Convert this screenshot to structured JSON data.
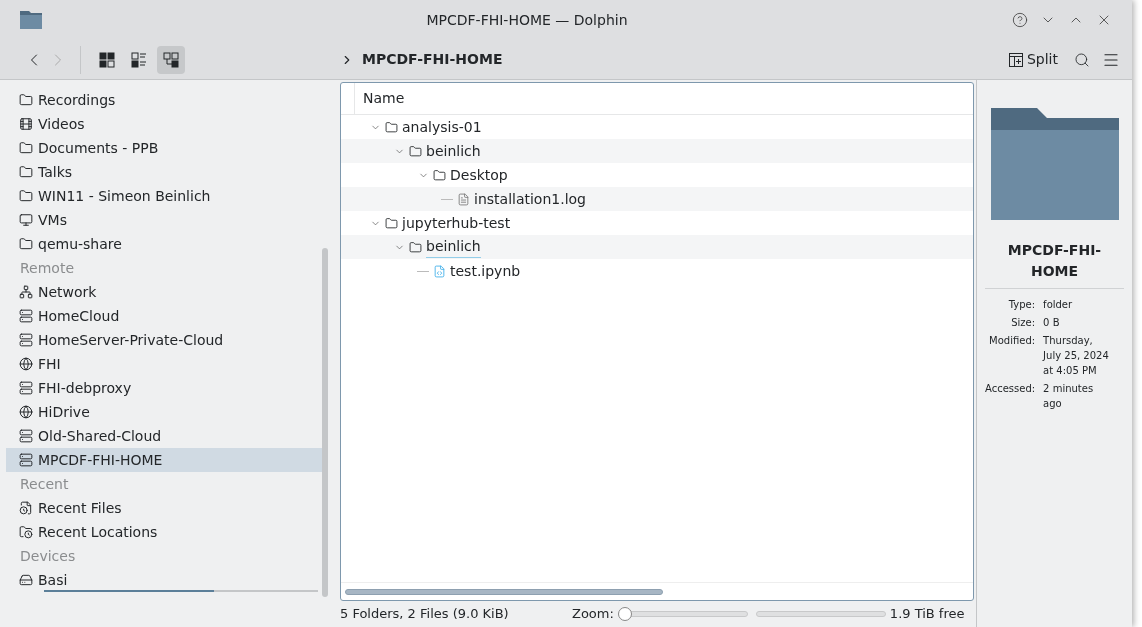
{
  "window": {
    "title": "MPCDF-FHI-HOME — Dolphin"
  },
  "toolbar": {
    "view_modes": [
      {
        "kind": "icons",
        "selected": false
      },
      {
        "kind": "compact",
        "selected": false
      },
      {
        "kind": "details",
        "selected": true
      }
    ],
    "breadcrumb": "MPCDF-FHI-HOME",
    "split_label": "Split"
  },
  "sidebar": {
    "sections": [
      {
        "items": [
          {
            "label": "Recordings",
            "kind": "folder",
            "selected": false
          },
          {
            "label": "Videos",
            "kind": "video",
            "selected": false
          },
          {
            "label": "Documents - PPB",
            "kind": "folder",
            "selected": false
          },
          {
            "label": "Talks",
            "kind": "folder",
            "selected": false
          },
          {
            "label": "WIN11 - Simeon Beinlich",
            "kind": "folder",
            "selected": false
          },
          {
            "label": "VMs",
            "kind": "monitor",
            "selected": false
          },
          {
            "label": "qemu-share",
            "kind": "folder",
            "selected": false
          }
        ]
      },
      {
        "title": "Remote",
        "items": [
          {
            "label": "Network",
            "kind": "network",
            "selected": false
          },
          {
            "label": "HomeCloud",
            "kind": "server",
            "selected": false
          },
          {
            "label": "HomeServer-Private-Cloud",
            "kind": "server",
            "selected": false
          },
          {
            "label": "FHI",
            "kind": "globe",
            "selected": false
          },
          {
            "label": "FHI-debproxy",
            "kind": "server",
            "selected": false
          },
          {
            "label": "HiDrive",
            "kind": "globe",
            "selected": false
          },
          {
            "label": "Old-Shared-Cloud",
            "kind": "server",
            "selected": false
          },
          {
            "label": "MPCDF-FHI-HOME",
            "kind": "server",
            "selected": true
          }
        ]
      },
      {
        "title": "Recent",
        "items": [
          {
            "label": "Recent Files",
            "kind": "recent-file",
            "selected": false
          },
          {
            "label": "Recent Locations",
            "kind": "recent-folder",
            "selected": false
          }
        ]
      },
      {
        "title": "Devices",
        "items": [
          {
            "label": "Basi",
            "kind": "drive",
            "selected": false,
            "level": 0.62
          }
        ]
      }
    ]
  },
  "view": {
    "column": "Name",
    "tree": [
      {
        "name": "analysis-01",
        "kind": "folder",
        "expanded": true,
        "focused": false,
        "children": [
          {
            "name": "beinlich",
            "kind": "folder",
            "expanded": true,
            "focused": false,
            "children": [
              {
                "name": "Desktop",
                "kind": "folder",
                "expanded": true,
                "focused": false,
                "children": [
                  {
                    "name": "installation1.log",
                    "kind": "text",
                    "focused": false
                  }
                ]
              }
            ]
          }
        ]
      },
      {
        "name": "jupyterhub-test",
        "kind": "folder",
        "expanded": true,
        "focused": false,
        "children": [
          {
            "name": "beinlich",
            "kind": "folder",
            "expanded": true,
            "focused": true,
            "children": [
              {
                "name": "test.ipynb",
                "kind": "notebook",
                "focused": false
              }
            ]
          }
        ]
      }
    ]
  },
  "info_panel": {
    "name": "MPCDF-FHI-HOME",
    "properties": [
      {
        "label": "Type:",
        "value": "folder"
      },
      {
        "label": "Size:",
        "value": "0 B"
      },
      {
        "label": "Modified:",
        "value": "Thursday, July 25, 2024 at 4:05 PM"
      },
      {
        "label": "Accessed:",
        "value": "2 minutes ago"
      }
    ]
  },
  "status_bar": {
    "summary": "5 Folders, 2 Files (9.0 KiB)",
    "zoom_label": "Zoom:",
    "zoom": {
      "level": 0
    },
    "free_space": {
      "level": 0
    },
    "free_label": "1.9 TiB free"
  }
}
